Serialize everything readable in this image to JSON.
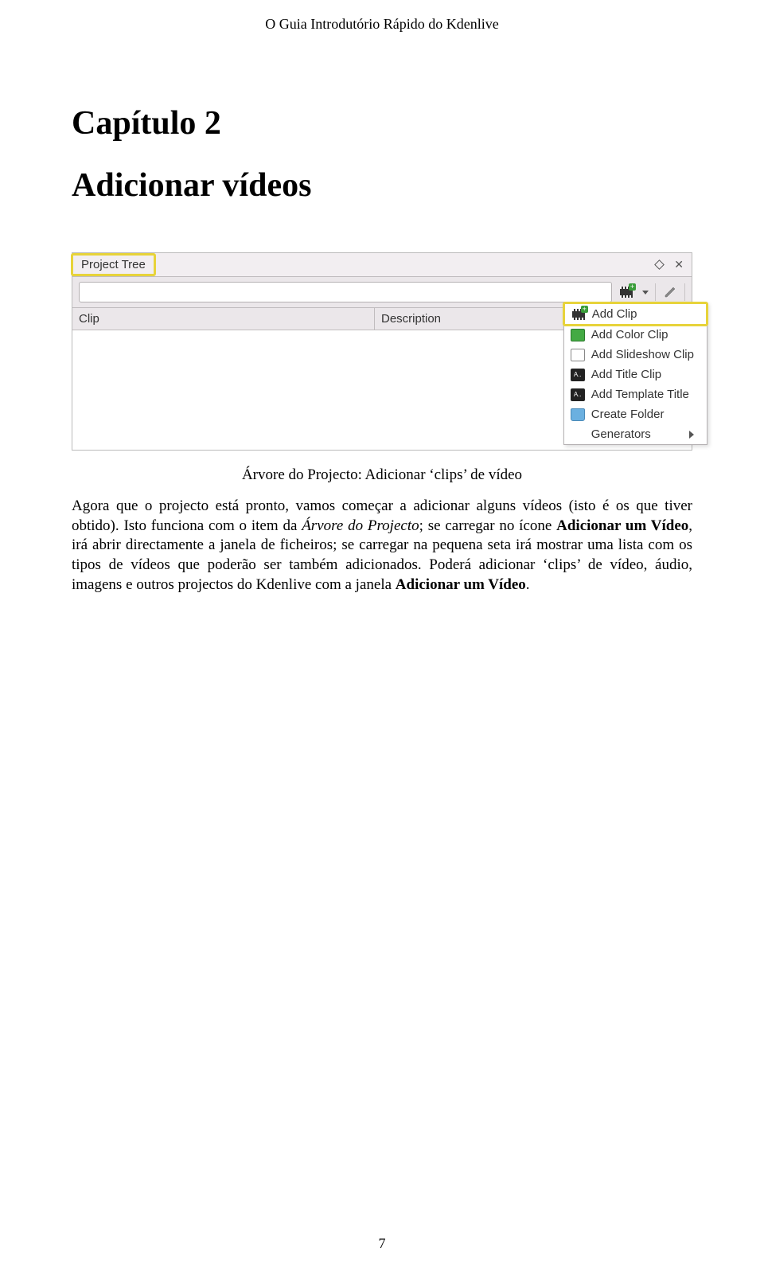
{
  "running_head": "O Guia Introdutório Rápido do Kdenlive",
  "chapter": {
    "num": "Capítulo 2",
    "title": "Adicionar vídeos"
  },
  "screenshot": {
    "tab_label": "Project Tree",
    "columns": {
      "clip": "Clip",
      "description": "Description"
    },
    "menu": {
      "add_clip": "Add Clip",
      "add_color_clip": "Add Color Clip",
      "add_slideshow_clip": "Add Slideshow Clip",
      "add_title_clip": "Add Title Clip",
      "add_template_title": "Add Template Title",
      "create_folder": "Create Folder",
      "generators": "Generators"
    }
  },
  "caption": "Árvore do Projecto: Adicionar ‘clips’ de vídeo",
  "paragraph": {
    "p1a": "Agora que o projecto está pronto, vamos começar a adicionar alguns vídeos (isto é os que tiver obtido). Isto funciona com o item da ",
    "p1b": "Árvore do Projecto",
    "p1c": "; se carregar no ícone ",
    "p1d": "Adicionar um Vídeo",
    "p1e": ", irá abrir directamente a janela de ficheiros; se carregar na pequena seta irá mostrar uma lista com os tipos de vídeos que poderão ser também adicionados. Poderá adicionar ‘clips’ de vídeo, áudio, imagens e outros projectos do Kdenlive com a janela ",
    "p1f": "Adicionar um Vídeo",
    "p1g": "."
  },
  "page_number": "7"
}
